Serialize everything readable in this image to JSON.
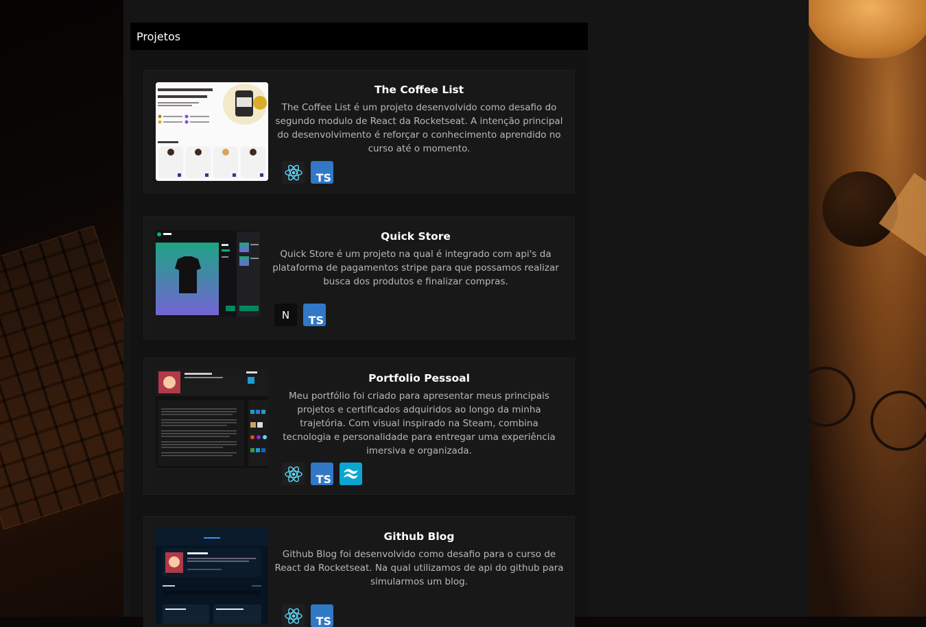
{
  "section": {
    "title": "Projetos"
  },
  "projects": [
    {
      "title": "The Coffee List",
      "description": "The Coffee List é um projeto desenvolvido como desafio do segundo modulo de React da Rocketseat. A intenção principal do desenvolvimento é reforçar o conhecimento aprendido no curso até o momento.",
      "techs": [
        "react-icon",
        "typescript-icon"
      ]
    },
    {
      "title": "Quick Store",
      "description": "Quick Store é um projeto na qual é integrado com api's da plataforma de pagamentos stripe para que possamos realizar busca dos produtos e finalizar compras.",
      "techs": [
        "nextjs-icon",
        "typescript-icon"
      ]
    },
    {
      "title": "Portfolio Pessoal",
      "description": "Meu portfólio foi criado para apresentar meus principais projetos e certificados adquiridos ao longo da minha trajetória. Com visual inspirado na Steam, combina tecnologia e personalidade para entregar uma experiência imersiva e organizada.",
      "techs": [
        "react-icon",
        "typescript-icon",
        "tailwind-icon"
      ]
    },
    {
      "title": "Github Blog",
      "description": "Github Blog foi desenvolvido como desafio para o curso de React da Rocketseat. Na qual utilizamos de api do github para simularmos um blog.",
      "techs": [
        "react-icon",
        "typescript-icon"
      ]
    }
  ],
  "icons": {
    "ts_label": "TS",
    "next_label": "N"
  },
  "colors": {
    "ts": "#3178c6",
    "react": "#61dafb",
    "tailwind": "#0ba5d1"
  }
}
